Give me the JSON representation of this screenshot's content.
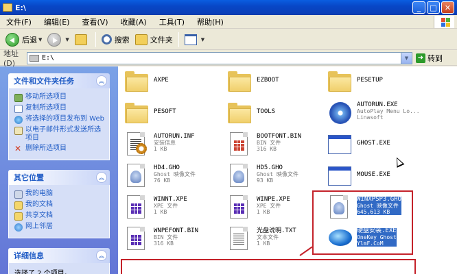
{
  "window": {
    "title": "E:\\",
    "minimize": "_",
    "maximize": "□",
    "close": "✕"
  },
  "menu": [
    "文件(F)",
    "编辑(E)",
    "查看(V)",
    "收藏(A)",
    "工具(T)",
    "帮助(H)"
  ],
  "toolbar": {
    "back": "后退",
    "search": "搜索",
    "folders": "文件夹"
  },
  "address": {
    "label": "地址(D)",
    "value": "E:\\",
    "go": "转到"
  },
  "tasks": {
    "file_tasks": {
      "title": "文件和文件夹任务",
      "items": [
        "移动所选项目",
        "复制所选项目",
        "将选择的项目发布到 Web",
        "以电子邮件形式发送所选项目",
        "删除所选项目"
      ]
    },
    "other_places": {
      "title": "其它位置",
      "items": [
        "我的电脑",
        "我的文档",
        "共享文档",
        "网上邻居"
      ]
    },
    "details": {
      "title": "详细信息",
      "text": "选择了 2 个项目。"
    }
  },
  "files": [
    {
      "name": "AXPE",
      "type": "folder"
    },
    {
      "name": "EZBOOT",
      "type": "folder"
    },
    {
      "name": "PESETUP",
      "type": "folder"
    },
    {
      "name": "PESOFT",
      "type": "folder"
    },
    {
      "name": "TOOLS",
      "type": "folder"
    },
    {
      "name": "AUTORUN.EXE",
      "sub": "AutoPlay Menu Lo...",
      "sub2": "Linasoft"
    },
    {
      "name": "AUTORUN.INF",
      "sub": "安装信息",
      "sub2": "1 KB"
    },
    {
      "name": "BOOTFONT.BIN",
      "sub": "BIN 文件",
      "sub2": "316 KB"
    },
    {
      "name": "GHOST.EXE"
    },
    {
      "name": "HD4.GHO",
      "sub": "Ghost 映像文件",
      "sub2": "76 KB"
    },
    {
      "name": "HD5.GHO",
      "sub": "Ghost 映像文件",
      "sub2": "93 KB"
    },
    {
      "name": "MOUSE.EXE"
    },
    {
      "name": "WINNT.XPE",
      "sub": "XPE 文件",
      "sub2": "1 KB"
    },
    {
      "name": "WINPE.XPE",
      "sub": "XPE 文件",
      "sub2": "1 KB"
    },
    {
      "name": "WINXPSP3.GHO",
      "sub": "Ghost 映像文件",
      "sub2": "645,613 KB"
    },
    {
      "name": "WNPEFONT.BIN",
      "sub": "BIN 文件",
      "sub2": "316 KB"
    },
    {
      "name": "光盘说明.TXT",
      "sub": "文本文件",
      "sub2": "1 KB"
    },
    {
      "name": "硬盘安装.EXE",
      "sub": "OneKey Ghost",
      "sub2": "YlmF.CoM"
    }
  ]
}
